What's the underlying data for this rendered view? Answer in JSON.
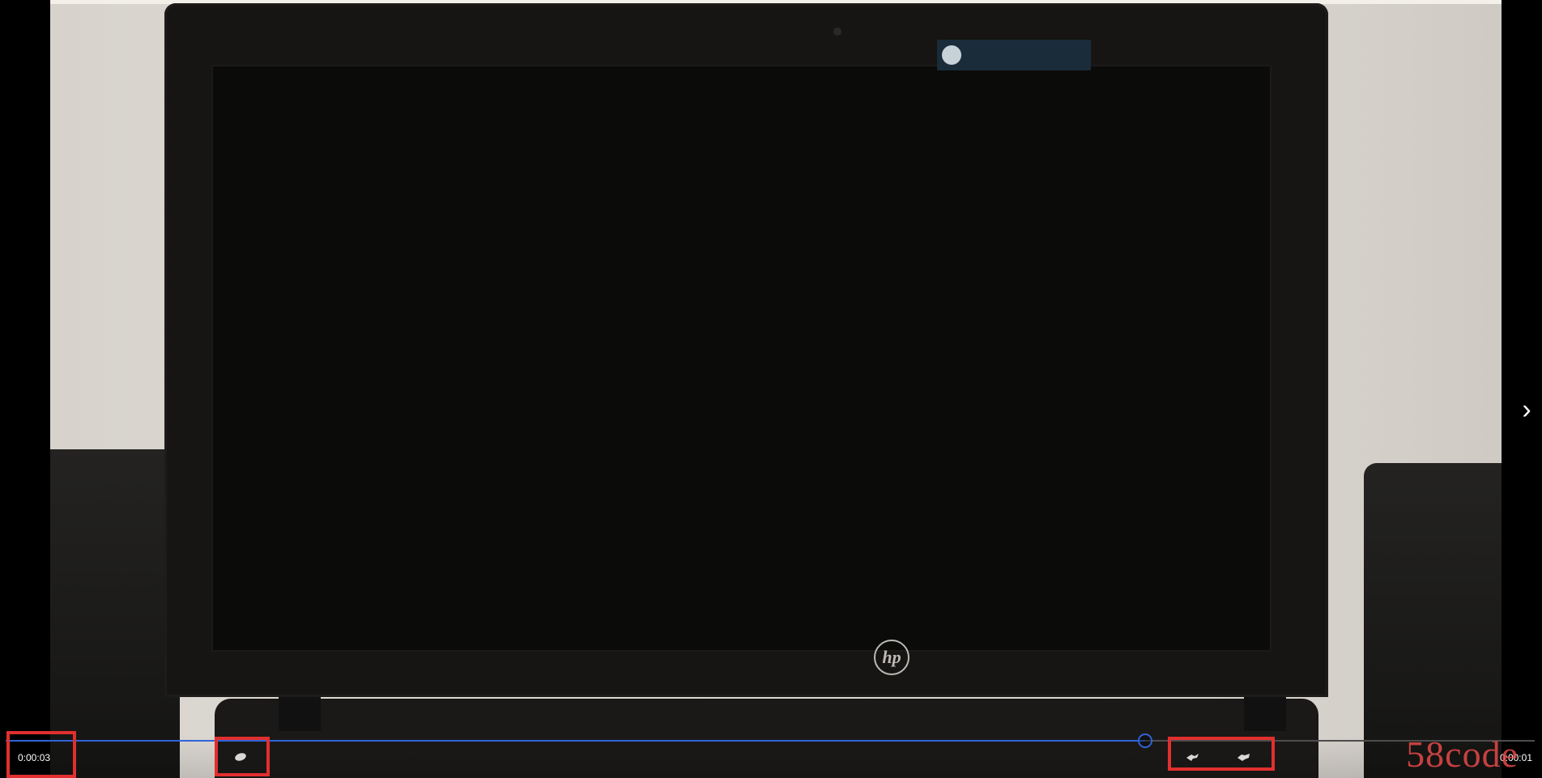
{
  "player": {
    "current_time": "0:00:03",
    "remaining_time": "0:00:01",
    "progress_fraction": 0.745
  },
  "overlay": {
    "watermark": "58code"
  },
  "icons": {
    "next": "chevron-right-icon",
    "single_control": "ellipse-icon",
    "pair_a": "bird-icon-a",
    "pair_b": "bird-icon-b"
  },
  "colors": {
    "accent": "#2f63d9",
    "highlight": "#e12f2f",
    "watermark": "#e54949"
  }
}
